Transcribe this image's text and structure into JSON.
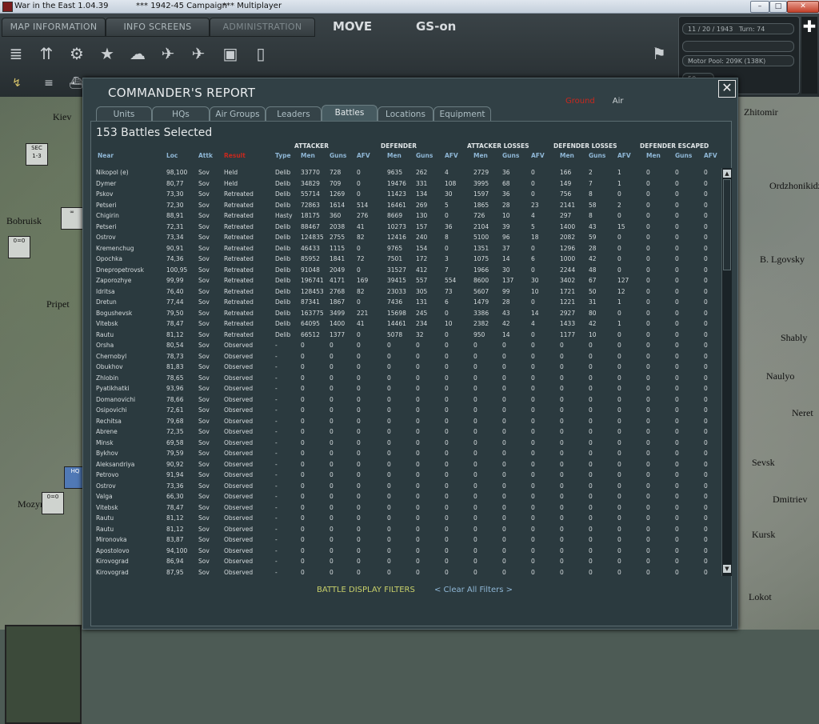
{
  "window": {
    "title": "War in the East 1.04.39",
    "sep1": "***",
    "campaign": "1942-45 Campaign",
    "sep2": "***",
    "mode": "Multiplayer",
    "btn_min": "–",
    "btn_max": "□",
    "btn_close": "✕"
  },
  "topbar": {
    "tabs": [
      "MAP INFORMATION",
      "INFO SCREENS",
      "ADMINISTRATION"
    ],
    "phase": "MOVE",
    "gs": "GS-on",
    "date": "11 / 20 / 1943",
    "turn": "Turn: 74",
    "motor_pool": "Motor Pool: 209K (138K)",
    "field_50": "50"
  },
  "map": {
    "labels": [
      "Zhitomir",
      "Kiev",
      "Bobruisk",
      "Pripet",
      "Ordzhonikidze",
      "B. Lgovsky",
      "Shably",
      "Naulyo",
      "Neret",
      "Sevsk",
      "Dmitriev",
      "Lokot",
      "Kursk",
      "Mozyr"
    ]
  },
  "dialog": {
    "title": "COMMANDER'S REPORT",
    "link_ground": "Ground",
    "link_air": "Air",
    "close": "✕",
    "tabs": [
      "Units",
      "HQs",
      "Air Groups",
      "Leaders",
      "Battles",
      "Locations",
      "Equipment"
    ],
    "active_tab": "Battles",
    "selected": "153 Battles Selected",
    "groups": [
      "ATTACKER",
      "DEFENDER",
      "ATTACKER LOSSES",
      "DEFENDER LOSSES",
      "DEFENDER ESCAPED"
    ],
    "headers": [
      "Near",
      "Loc",
      "Attk",
      "Result",
      "Type",
      "Men",
      "Guns",
      "AFV",
      "Men",
      "Guns",
      "AFV",
      "Men",
      "Guns",
      "AFV",
      "Men",
      "Guns",
      "AFV",
      "Men",
      "Guns",
      "AFV"
    ],
    "filters_label": "BATTLE DISPLAY FILTERS",
    "clear_filters": "< Clear All Filters >",
    "scroll_up": "▲",
    "scroll_down": "▼"
  },
  "battles": [
    [
      "Nikopol (e)",
      "98,100",
      "Sov",
      "Held",
      "Delib",
      "33770",
      "728",
      "0",
      "9635",
      "262",
      "4",
      "2729",
      "36",
      "0",
      "166",
      "2",
      "1",
      "0",
      "0",
      "0"
    ],
    [
      "Dymer",
      "80,77",
      "Sov",
      "Held",
      "Delib",
      "34829",
      "709",
      "0",
      "19476",
      "331",
      "108",
      "3995",
      "68",
      "0",
      "149",
      "7",
      "1",
      "0",
      "0",
      "0"
    ],
    [
      "Pskov",
      "73,30",
      "Sov",
      "Retreated",
      "Delib",
      "55714",
      "1269",
      "0",
      "11423",
      "134",
      "30",
      "1597",
      "36",
      "0",
      "756",
      "8",
      "0",
      "0",
      "0",
      "0"
    ],
    [
      "Petseri",
      "72,30",
      "Sov",
      "Retreated",
      "Delib",
      "72863",
      "1614",
      "514",
      "16461",
      "269",
      "5",
      "1865",
      "28",
      "23",
      "2141",
      "58",
      "2",
      "0",
      "0",
      "0"
    ],
    [
      "Chigirin",
      "88,91",
      "Sov",
      "Retreated",
      "Hasty",
      "18175",
      "360",
      "276",
      "8669",
      "130",
      "0",
      "726",
      "10",
      "4",
      "297",
      "8",
      "0",
      "0",
      "0",
      "0"
    ],
    [
      "Petseri",
      "72,31",
      "Sov",
      "Retreated",
      "Delib",
      "88467",
      "2038",
      "41",
      "10273",
      "157",
      "36",
      "2104",
      "39",
      "5",
      "1400",
      "43",
      "15",
      "0",
      "0",
      "0"
    ],
    [
      "Ostrov",
      "73,34",
      "Sov",
      "Retreated",
      "Delib",
      "124835",
      "2755",
      "82",
      "12416",
      "240",
      "8",
      "5100",
      "96",
      "18",
      "2082",
      "59",
      "0",
      "0",
      "0",
      "0"
    ],
    [
      "Kremenchug",
      "90,91",
      "Sov",
      "Retreated",
      "Delib",
      "46433",
      "1115",
      "0",
      "9765",
      "154",
      "0",
      "1351",
      "37",
      "0",
      "1296",
      "28",
      "0",
      "0",
      "0",
      "0"
    ],
    [
      "Opochka",
      "74,36",
      "Sov",
      "Retreated",
      "Delib",
      "85952",
      "1841",
      "72",
      "7501",
      "172",
      "3",
      "1075",
      "14",
      "6",
      "1000",
      "42",
      "0",
      "0",
      "0",
      "0"
    ],
    [
      "Dnepropetrovsk",
      "100,95",
      "Sov",
      "Retreated",
      "Delib",
      "91048",
      "2049",
      "0",
      "31527",
      "412",
      "7",
      "1966",
      "30",
      "0",
      "2244",
      "48",
      "0",
      "0",
      "0",
      "0"
    ],
    [
      "Zaporozhye",
      "99,99",
      "Sov",
      "Retreated",
      "Delib",
      "196741",
      "4171",
      "169",
      "39415",
      "557",
      "554",
      "8600",
      "137",
      "30",
      "3402",
      "67",
      "127",
      "0",
      "0",
      "0"
    ],
    [
      "Idritsa",
      "76,40",
      "Sov",
      "Retreated",
      "Delib",
      "128453",
      "2768",
      "82",
      "23033",
      "305",
      "73",
      "5607",
      "99",
      "10",
      "1721",
      "50",
      "12",
      "0",
      "0",
      "0"
    ],
    [
      "Dretun",
      "77,44",
      "Sov",
      "Retreated",
      "Delib",
      "87341",
      "1867",
      "0",
      "7436",
      "131",
      "6",
      "1479",
      "28",
      "0",
      "1221",
      "31",
      "1",
      "0",
      "0",
      "0"
    ],
    [
      "Bogushevsk",
      "79,50",
      "Sov",
      "Retreated",
      "Delib",
      "163775",
      "3499",
      "221",
      "15698",
      "245",
      "0",
      "3386",
      "43",
      "14",
      "2927",
      "80",
      "0",
      "0",
      "0",
      "0"
    ],
    [
      "Vitebsk",
      "78,47",
      "Sov",
      "Retreated",
      "Delib",
      "64095",
      "1400",
      "41",
      "14461",
      "234",
      "10",
      "2382",
      "42",
      "4",
      "1433",
      "42",
      "1",
      "0",
      "0",
      "0"
    ],
    [
      "Rautu",
      "81,12",
      "Sov",
      "Retreated",
      "Delib",
      "66512",
      "1377",
      "0",
      "5078",
      "32",
      "0",
      "950",
      "14",
      "0",
      "1177",
      "10",
      "0",
      "0",
      "0",
      "0"
    ],
    [
      "Orsha",
      "80,54",
      "Sov",
      "Observed",
      "-",
      "0",
      "0",
      "0",
      "0",
      "0",
      "0",
      "0",
      "0",
      "0",
      "0",
      "0",
      "0",
      "0",
      "0",
      "0"
    ],
    [
      "Chernobyl",
      "78,73",
      "Sov",
      "Observed",
      "-",
      "0",
      "0",
      "0",
      "0",
      "0",
      "0",
      "0",
      "0",
      "0",
      "0",
      "0",
      "0",
      "0",
      "0",
      "0"
    ],
    [
      "Obukhov",
      "81,83",
      "Sov",
      "Observed",
      "-",
      "0",
      "0",
      "0",
      "0",
      "0",
      "0",
      "0",
      "0",
      "0",
      "0",
      "0",
      "0",
      "0",
      "0",
      "0"
    ],
    [
      "Zhlobin",
      "78,65",
      "Sov",
      "Observed",
      "-",
      "0",
      "0",
      "0",
      "0",
      "0",
      "0",
      "0",
      "0",
      "0",
      "0",
      "0",
      "0",
      "0",
      "0",
      "0"
    ],
    [
      "Pyatikhatki",
      "93,96",
      "Sov",
      "Observed",
      "-",
      "0",
      "0",
      "0",
      "0",
      "0",
      "0",
      "0",
      "0",
      "0",
      "0",
      "0",
      "0",
      "0",
      "0",
      "0"
    ],
    [
      "Domanovichi",
      "78,66",
      "Sov",
      "Observed",
      "-",
      "0",
      "0",
      "0",
      "0",
      "0",
      "0",
      "0",
      "0",
      "0",
      "0",
      "0",
      "0",
      "0",
      "0",
      "0"
    ],
    [
      "Osipovichi",
      "72,61",
      "Sov",
      "Observed",
      "-",
      "0",
      "0",
      "0",
      "0",
      "0",
      "0",
      "0",
      "0",
      "0",
      "0",
      "0",
      "0",
      "0",
      "0",
      "0"
    ],
    [
      "Rechitsa",
      "79,68",
      "Sov",
      "Observed",
      "-",
      "0",
      "0",
      "0",
      "0",
      "0",
      "0",
      "0",
      "0",
      "0",
      "0",
      "0",
      "0",
      "0",
      "0",
      "0"
    ],
    [
      "Abrene",
      "72,35",
      "Sov",
      "Observed",
      "-",
      "0",
      "0",
      "0",
      "0",
      "0",
      "0",
      "0",
      "0",
      "0",
      "0",
      "0",
      "0",
      "0",
      "0",
      "0"
    ],
    [
      "Minsk",
      "69,58",
      "Sov",
      "Observed",
      "-",
      "0",
      "0",
      "0",
      "0",
      "0",
      "0",
      "0",
      "0",
      "0",
      "0",
      "0",
      "0",
      "0",
      "0",
      "0"
    ],
    [
      "Bykhov",
      "79,59",
      "Sov",
      "Observed",
      "-",
      "0",
      "0",
      "0",
      "0",
      "0",
      "0",
      "0",
      "0",
      "0",
      "0",
      "0",
      "0",
      "0",
      "0",
      "0"
    ],
    [
      "Aleksandriya",
      "90,92",
      "Sov",
      "Observed",
      "-",
      "0",
      "0",
      "0",
      "0",
      "0",
      "0",
      "0",
      "0",
      "0",
      "0",
      "0",
      "0",
      "0",
      "0",
      "0"
    ],
    [
      "Petrovo",
      "91,94",
      "Sov",
      "Observed",
      "-",
      "0",
      "0",
      "0",
      "0",
      "0",
      "0",
      "0",
      "0",
      "0",
      "0",
      "0",
      "0",
      "0",
      "0",
      "0"
    ],
    [
      "Ostrov",
      "73,36",
      "Sov",
      "Observed",
      "-",
      "0",
      "0",
      "0",
      "0",
      "0",
      "0",
      "0",
      "0",
      "0",
      "0",
      "0",
      "0",
      "0",
      "0",
      "0"
    ],
    [
      "Valga",
      "66,30",
      "Sov",
      "Observed",
      "-",
      "0",
      "0",
      "0",
      "0",
      "0",
      "0",
      "0",
      "0",
      "0",
      "0",
      "0",
      "0",
      "0",
      "0",
      "0"
    ],
    [
      "Vitebsk",
      "78,47",
      "Sov",
      "Observed",
      "-",
      "0",
      "0",
      "0",
      "0",
      "0",
      "0",
      "0",
      "0",
      "0",
      "0",
      "0",
      "0",
      "0",
      "0",
      "0"
    ],
    [
      "Rautu",
      "81,12",
      "Sov",
      "Observed",
      "-",
      "0",
      "0",
      "0",
      "0",
      "0",
      "0",
      "0",
      "0",
      "0",
      "0",
      "0",
      "0",
      "0",
      "0",
      "0"
    ],
    [
      "Rautu",
      "81,12",
      "Sov",
      "Observed",
      "-",
      "0",
      "0",
      "0",
      "0",
      "0",
      "0",
      "0",
      "0",
      "0",
      "0",
      "0",
      "0",
      "0",
      "0",
      "0"
    ],
    [
      "Mironovka",
      "83,87",
      "Sov",
      "Observed",
      "-",
      "0",
      "0",
      "0",
      "0",
      "0",
      "0",
      "0",
      "0",
      "0",
      "0",
      "0",
      "0",
      "0",
      "0",
      "0"
    ],
    [
      "Apostolovo",
      "94,100",
      "Sov",
      "Observed",
      "-",
      "0",
      "0",
      "0",
      "0",
      "0",
      "0",
      "0",
      "0",
      "0",
      "0",
      "0",
      "0",
      "0",
      "0",
      "0"
    ],
    [
      "Kirovograd",
      "86,94",
      "Sov",
      "Observed",
      "-",
      "0",
      "0",
      "0",
      "0",
      "0",
      "0",
      "0",
      "0",
      "0",
      "0",
      "0",
      "0",
      "0",
      "0",
      "0"
    ],
    [
      "Kirovograd",
      "87,95",
      "Sov",
      "Observed",
      "-",
      "0",
      "0",
      "0",
      "0",
      "0",
      "0",
      "0",
      "0",
      "0",
      "0",
      "0",
      "0",
      "0",
      "0",
      "0"
    ]
  ],
  "colors": {
    "result_header": "#c8281e",
    "column_header": "#8fb7d6",
    "filters": "#c8d06a"
  }
}
